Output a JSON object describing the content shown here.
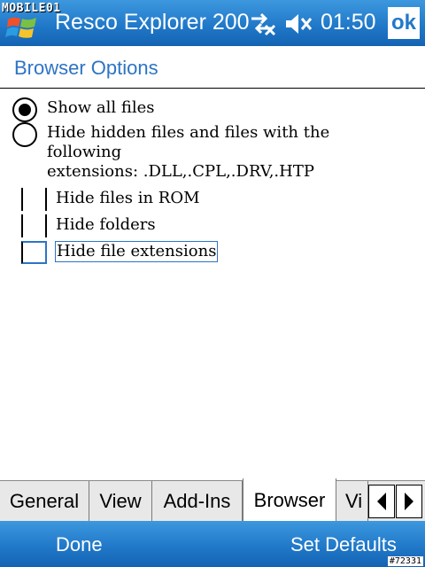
{
  "watermark": "MOBILE01",
  "titlebar": {
    "title": "Resco Explorer 200",
    "time": "01:50",
    "ok_label": "ok",
    "icons": [
      "windows-start-icon",
      "connectivity-icon",
      "volume-muted-icon"
    ]
  },
  "page": {
    "title": "Browser Options",
    "radio_options": [
      {
        "label": "Show all files",
        "selected": true
      },
      {
        "label": "Hide hidden files and files with the following",
        "label_line2": "extensions: .DLL,.CPL,.DRV,.HTP",
        "selected": false
      }
    ],
    "checkboxes": [
      {
        "label": "Hide files in ROM",
        "checked": false
      },
      {
        "label": "Hide folders",
        "checked": false
      },
      {
        "label": "Hide file extensions",
        "checked": false,
        "focused": true
      }
    ]
  },
  "tabs": [
    {
      "label": "General",
      "active": false
    },
    {
      "label": "View",
      "active": false
    },
    {
      "label": "Add-Ins",
      "active": false
    },
    {
      "label": "Browser",
      "active": true
    },
    {
      "label": "Vi",
      "active": false
    }
  ],
  "softkeys": {
    "left": "Done",
    "right": "Set Defaults"
  },
  "image_id": "#72331",
  "colors": {
    "titlebar": "#2179c9",
    "accent_text": "#2d74c5",
    "tabstrip": "#e8e8e8"
  }
}
